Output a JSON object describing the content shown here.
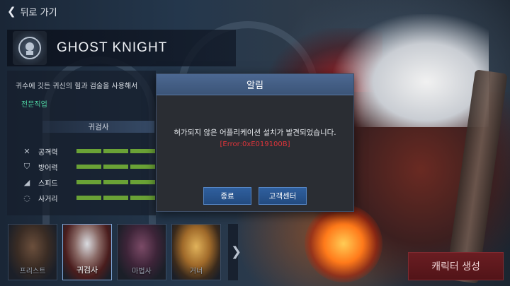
{
  "nav": {
    "back_label": "뒤로 가기"
  },
  "class_panel": {
    "name": "GHOST KNIGHT",
    "description": "귀수에 깃든 귀신의 힘과 검술을 사용해서",
    "specialty_link": "전문직업",
    "weapon_title": "귀검사",
    "stats": [
      {
        "label": "공격력",
        "icon": "crossed-swords-icon",
        "filled": 3
      },
      {
        "label": "방어력",
        "icon": "shield-icon",
        "filled": 3
      },
      {
        "label": "스피드",
        "icon": "boot-icon",
        "filled": 3
      },
      {
        "label": "사거리",
        "icon": "crosshair-icon",
        "filled": 3
      }
    ]
  },
  "dialog": {
    "title": "알림",
    "message": "허가되지 않은 어플리케이션 설치가 발견되었습니다.",
    "error_code": "[Error:0xE019100B]",
    "exit_label": "종료",
    "support_label": "고객센터"
  },
  "characters": [
    {
      "name": "프리스트",
      "selected": false
    },
    {
      "name": "귀검사",
      "selected": true
    },
    {
      "name": "마법사",
      "selected": false
    },
    {
      "name": "거너",
      "selected": false
    }
  ],
  "create_button": {
    "label": "캐릭터 생성"
  },
  "colors": {
    "accent_blue": "#3b5477",
    "stat_bar": "#6aa236",
    "error_red": "#e0343a",
    "specialty_green": "#4dd0a0",
    "create_red": "#6a1d22"
  }
}
